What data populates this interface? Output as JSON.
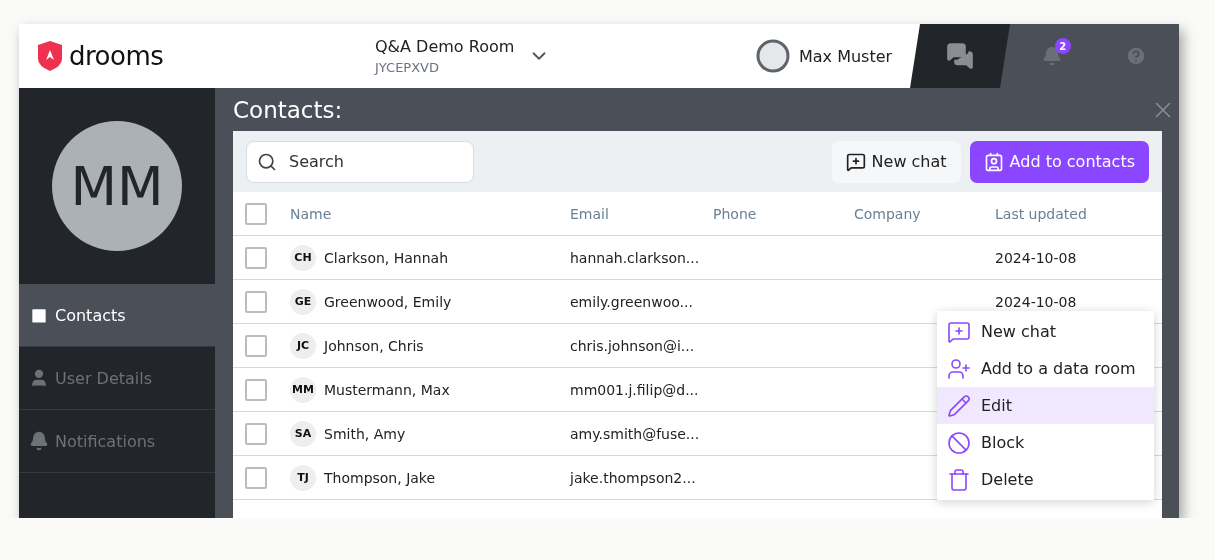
{
  "header": {
    "brand": "drooms",
    "room_name": "Q&A Demo Room",
    "room_code": "JYCEPXVD",
    "user_name": "Max Muster",
    "notification_count": "2"
  },
  "sidebar": {
    "avatar_initials": "MM",
    "items": [
      {
        "label": "Contacts",
        "kind": "contacts",
        "selected": true
      },
      {
        "label": "User Details",
        "kind": "user",
        "selected": false
      },
      {
        "label": "Notifications",
        "kind": "bell",
        "selected": false
      }
    ]
  },
  "panel": {
    "title": "Contacts:",
    "search": {
      "placeholder": "Search"
    },
    "buttons": [
      {
        "label": "New chat",
        "kind": "secondary"
      },
      {
        "label": "Add to contacts",
        "kind": "primary"
      }
    ]
  },
  "table": {
    "columns": [
      "Name",
      "Email",
      "Phone",
      "Company",
      "Last updated"
    ],
    "header_checked": false,
    "rows": [
      {
        "initials": "CH",
        "name": "Clarkson, Hannah",
        "email": "hannah.clarkson...",
        "phone": "",
        "company": "",
        "updated": "2024-10-08",
        "checked": false
      },
      {
        "initials": "GE",
        "name": "Greenwood, Emily",
        "email": "emily.greenwoo...",
        "phone": "",
        "company": "",
        "updated": "2024-10-08",
        "checked": false
      },
      {
        "initials": "JC",
        "name": "Johnson, Chris",
        "email": "chris.johnson@i...",
        "checked": false
      },
      {
        "initials": "MM",
        "name": "Mustermann, Max",
        "email": "mm001.j.filip@d...",
        "checked": false
      },
      {
        "initials": "SA",
        "name": "Smith, Amy",
        "email": "amy.smith@fuse...",
        "checked": false
      },
      {
        "initials": "TJ",
        "name": "Thompson, Jake",
        "email": "jake.thompson2...",
        "checked": false
      }
    ]
  },
  "context_menu": [
    {
      "label": "New chat",
      "kind": "chat",
      "selected": false
    },
    {
      "label": "Add to a data room",
      "kind": "user-add",
      "selected": false
    },
    {
      "label": "Edit",
      "kind": "edit",
      "selected": true
    },
    {
      "label": "Block",
      "kind": "block",
      "selected": false
    },
    {
      "label": "Delete",
      "kind": "delete",
      "selected": false
    }
  ]
}
